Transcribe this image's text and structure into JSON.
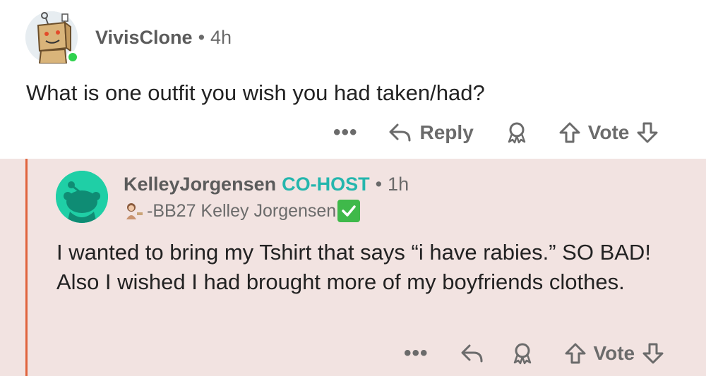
{
  "comment": {
    "author": "VivisClone",
    "separator": "•",
    "time": "4h",
    "text": "What is one outfit you wish you had taken/had?",
    "actions": {
      "more": "•••",
      "reply_label": "Reply",
      "vote_label": "Vote"
    }
  },
  "reply": {
    "author": "KelleyJorgensen",
    "badge": "CO-HOST",
    "separator": "•",
    "time": "1h",
    "flair_text": "-BB27 Kelley Jorgensen",
    "text": "I wanted to bring my Tshirt that says “i have rabies.” SO BAD!  Also I wished I had brought more of my boyfriends clothes.",
    "actions": {
      "more": "•••",
      "vote_label": "Vote"
    }
  },
  "colors": {
    "reply_background": "#f2e3e1",
    "thread_line": "#e0633c",
    "cohost_badge": "#24b6ad",
    "online_status": "#2fd24e",
    "avatar_teal": "#1fcfa6"
  },
  "icons": [
    "robot-avatar-icon",
    "snoo-avatar-icon",
    "reply-arrow-icon",
    "award-icon",
    "upvote-arrow-icon",
    "downvote-arrow-icon",
    "flair-emoji-icon",
    "checkmark-icon"
  ]
}
